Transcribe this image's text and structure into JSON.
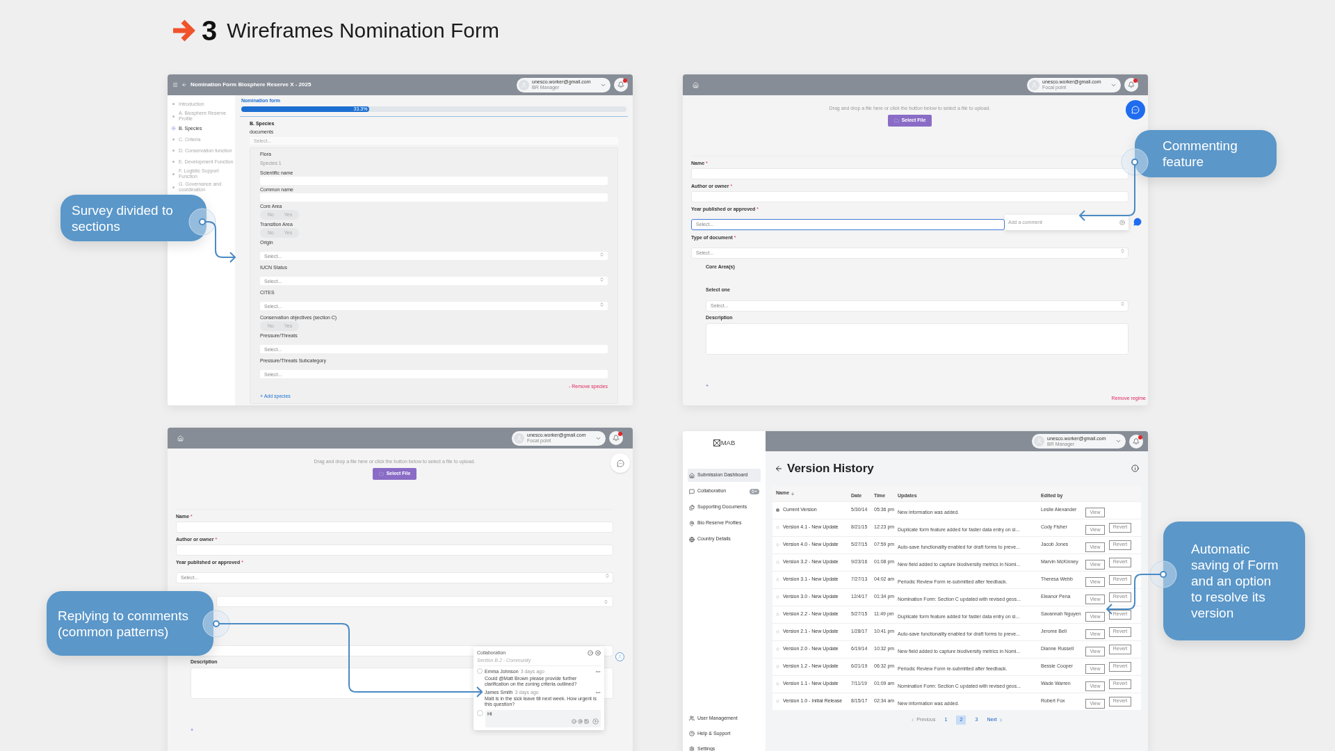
{
  "header": {
    "step": "3",
    "title": "Wireframes Nomination Form"
  },
  "form_panel": {
    "title": "Nomination Form Biosphere Reserve X - 2025",
    "user": {
      "email": "unesco.worker@gmail.com",
      "role": "BR Manager"
    },
    "sections": [
      {
        "label": "Introduction",
        "selected": false
      },
      {
        "label": "A. Biosphere Reserve Profile",
        "selected": false
      },
      {
        "label": "B. Species",
        "selected": true
      },
      {
        "label": "C. Criteria",
        "selected": false
      },
      {
        "label": "D. Conservation function",
        "selected": false
      },
      {
        "label": "E. Development Function",
        "selected": false
      },
      {
        "label": "F. Logistic Support Function",
        "selected": false
      },
      {
        "label": "G. Governance and coordination",
        "selected": false
      }
    ],
    "progress": {
      "label": "Nomination form",
      "level": 0.333,
      "reading": "33.3%"
    },
    "section_title": "B. Species",
    "documents": {
      "label": "documents",
      "placeholder": "Select..."
    },
    "species": {
      "group": "Flora",
      "name": "Species 1",
      "fields": [
        {
          "kind": "text",
          "label": "Scientific name"
        },
        {
          "kind": "text",
          "label": "Common name"
        },
        {
          "kind": "toggle",
          "label": "Core Area",
          "options": [
            "No",
            "Yes"
          ]
        },
        {
          "kind": "toggle",
          "label": "Transition Area",
          "options": [
            "No",
            "Yes"
          ]
        },
        {
          "kind": "select",
          "label": "Origin",
          "placeholder": "Select..."
        },
        {
          "kind": "select",
          "label": "IUCN Status",
          "placeholder": "Select..."
        },
        {
          "kind": "select",
          "label": "CITES",
          "placeholder": "Select..."
        },
        {
          "kind": "toggle",
          "label": "Conservation objectives (section C)",
          "options": [
            "No",
            "Yes"
          ]
        },
        {
          "kind": "plain",
          "label": "Pressure/Threats",
          "placeholder": "Select..."
        },
        {
          "kind": "plain",
          "label": "Pressure/Threats Subcategory",
          "placeholder": "Select..."
        }
      ],
      "remove": "- Remove species",
      "add": "+ Add species"
    }
  },
  "comment_panel": {
    "user": {
      "email": "unesco.worker@gmail.com",
      "role": "Focal point"
    },
    "upload": {
      "hint": "Drag and drop a file here or click the button below to select a file to upload.",
      "button": "Select File"
    },
    "fields": [
      {
        "kind": "text",
        "label": "Name",
        "required_mark": "*"
      },
      {
        "kind": "text",
        "label": "Author or owner",
        "required_mark": "*"
      },
      {
        "kind": "select",
        "label": "Year published or approved",
        "required_mark": "*",
        "placeholder": "Select...",
        "focused": true
      },
      {
        "kind": "select",
        "label": "Type of document",
        "required_mark": "*",
        "placeholder": "Select...",
        "focused": false
      }
    ],
    "comment": {
      "placeholder": "Add a comment"
    },
    "core": {
      "title": "Core Area(s)",
      "select_label": "Select one",
      "placeholder": "Select...",
      "description_label": "Description"
    },
    "add": "+",
    "remove": "Remove regime"
  },
  "reply_panel": {
    "user": {
      "email": "unesco.worker@gmail.com",
      "role": "Focal point"
    },
    "upload": {
      "hint": "Drag and drop a file here or click the button below to select a file to upload.",
      "button": "Select File"
    },
    "fields": [
      {
        "kind": "text",
        "label": "Name",
        "required_mark": "*"
      },
      {
        "kind": "text",
        "label": "Author or owner",
        "required_mark": "*"
      },
      {
        "kind": "select",
        "label": "Year published or approved",
        "required_mark": "*",
        "placeholder": "Select...",
        "focused": false
      }
    ],
    "description_label": "Description",
    "add": "+",
    "collaboration": {
      "title": "Collaboration",
      "section": "Section B.2 - Community",
      "comments": [
        {
          "author": "Emma Johnson",
          "time": "3 days ago",
          "text": "Could @Matt Brown please provide further clarification on the zoning criteria outlined?"
        },
        {
          "author": "James Smith",
          "time": "3 days ago",
          "text": "Matt is in the sick leave till next week. How urgent is this question?"
        }
      ],
      "reply": {
        "value": "Hi"
      }
    }
  },
  "versions_panel": {
    "logo": "MAB",
    "user": {
      "email": "unesco.worker@gmail.com",
      "role": "BR Manager"
    },
    "nav": [
      {
        "label": "Submission Dashboard",
        "selected": true
      },
      {
        "label": "Collaboration",
        "selected": false,
        "badge": "6+"
      },
      {
        "label": "Supporting Documents",
        "selected": false
      },
      {
        "label": "Bio Reserve Profiles",
        "selected": false
      },
      {
        "label": "Country Details",
        "selected": false
      }
    ],
    "bottom_nav": [
      {
        "label": "User Management"
      },
      {
        "label": "Help & Support"
      },
      {
        "label": "Settings"
      }
    ],
    "title": "Version History",
    "columns": [
      "Name",
      "Date",
      "Time",
      "Updates",
      "Edited by"
    ],
    "rows": [
      {
        "name": "Current Version",
        "date": "5/30/14",
        "time": "05:36 pm",
        "update": "New information was added.",
        "editor": "Leslie Alexander",
        "selected": true,
        "view": "View"
      },
      {
        "name": "Version 4.1 - New Update",
        "date": "8/21/15",
        "time": "12:23 pm",
        "update": "Duplicate form feature added for faster data entry on si...",
        "editor": "Cody Fisher",
        "selected": false,
        "view": "View",
        "revert": "Revert"
      },
      {
        "name": "Version 4.0 - New Update",
        "date": "5/27/15",
        "time": "07:59 pm",
        "update": "Auto-save functionality enabled for draft forms to preve...",
        "editor": "Jacob Jones",
        "selected": false,
        "view": "View",
        "revert": "Revert"
      },
      {
        "name": "Version 3.2 - New Update",
        "date": "9/23/16",
        "time": "01:08 pm",
        "update": "New field added to capture biodiversity metrics in Nomi...",
        "editor": "Marvin McKinney",
        "selected": false,
        "view": "View",
        "revert": "Revert"
      },
      {
        "name": "Version 3.1 - New Update",
        "date": "7/27/13",
        "time": "04:02 am",
        "update": "Periodic Review Form re-submitted after feedback.",
        "editor": "Theresa Webb",
        "selected": false,
        "view": "View",
        "revert": "Revert"
      },
      {
        "name": "Version 3.0 - New Update",
        "date": "12/4/17",
        "time": "01:34 pm",
        "update": "Nomination Form: Section C updated with revised geos...",
        "editor": "Eleanor Pena",
        "selected": false,
        "view": "View",
        "revert": "Revert"
      },
      {
        "name": "Version 2.2 - New Update",
        "date": "5/27/15",
        "time": "11:49 pm",
        "update": "Duplicate form feature added for faster data entry on si...",
        "editor": "Savannah Nguyen",
        "selected": false,
        "view": "View",
        "revert": "Revert"
      },
      {
        "name": "Version 2.1 - New Update",
        "date": "1/28/17",
        "time": "10:41 pm",
        "update": "Auto-save functionality enabled for draft forms to preve...",
        "editor": "Jerome Bell",
        "selected": false,
        "view": "View",
        "revert": "Revert"
      },
      {
        "name": "Version 2.0 - New Update",
        "date": "6/19/14",
        "time": "10:32 pm",
        "update": "New field added to capture biodiversity metrics in Nomi...",
        "editor": "Dianne Russell",
        "selected": false,
        "view": "View",
        "revert": "Revert"
      },
      {
        "name": "Version 1.2 - New Update",
        "date": "6/21/19",
        "time": "06:32 pm",
        "update": "Periodic Review Form re-submitted after feedback.",
        "editor": "Bessie Cooper",
        "selected": false,
        "view": "View",
        "revert": "Revert"
      },
      {
        "name": "Version 1.1 - New Update",
        "date": "7/11/19",
        "time": "01:09 am",
        "update": "Nomination Form: Section C updated with revised geos...",
        "editor": "Wade Warren",
        "selected": false,
        "view": "View",
        "revert": "Revert"
      },
      {
        "name": "Version 1.0 - Initial Release",
        "date": "8/15/17",
        "time": "02:34 am",
        "update": "New information was added.",
        "editor": "Robert Fox",
        "selected": false,
        "view": "View",
        "revert": "Revert"
      }
    ],
    "pagination": {
      "previous": "Previous",
      "pages": [
        {
          "label": "1",
          "selected": false
        },
        {
          "label": "2",
          "selected": true
        },
        {
          "label": "3",
          "selected": false
        }
      ],
      "next": "Next"
    }
  },
  "callouts": [
    {
      "text": "Survey divided to sections"
    },
    {
      "text": "Commenting feature"
    },
    {
      "text": "Replying to comments (common patterns)"
    },
    {
      "text": "Automatic saving of Form and an option to resolve its version"
    }
  ]
}
